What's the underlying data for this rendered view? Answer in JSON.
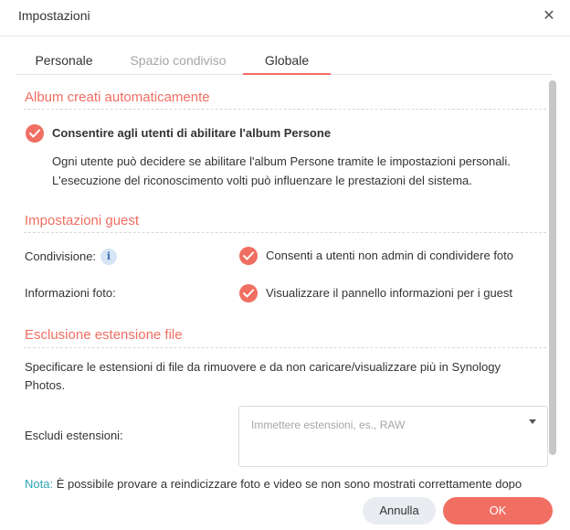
{
  "dialog": {
    "title": "Impostazioni"
  },
  "tabs": [
    {
      "label": "Personale"
    },
    {
      "label": "Spazio condiviso"
    },
    {
      "label": "Globale"
    }
  ],
  "album": {
    "heading": "Album creati automaticamente",
    "option_label": "Consentire agli utenti di abilitare l'album Persone",
    "desc_line1": "Ogni utente può decidere se abilitare l'album Persone tramite le impostazioni personali.",
    "desc_line2": "L'esecuzione del riconoscimento volti può influenzare le prestazioni del sistema."
  },
  "guest": {
    "heading": "Impostazioni guest",
    "sharing_label": "Condivisione:",
    "sharing_option": "Consenti a utenti non admin di condividere foto",
    "photoinfo_label": "Informazioni foto:",
    "photoinfo_option": "Visualizzare il pannello informazioni per i guest"
  },
  "exclusion": {
    "heading": "Esclusione estensione file",
    "desc_line1": "Specificare le estensioni di file da rimuovere e da non caricare/visualizzare più in Synology",
    "desc_line2": "Photos.",
    "field_label": "Escludi estensioni:",
    "placeholder": "Immettere estensioni, es., RAW"
  },
  "note": {
    "label": "Nota:",
    "text": " È possibile provare a reindicizzare foto e video se non sono mostrati correttamente dopo"
  },
  "footer": {
    "cancel": "Annulla",
    "ok": "OK"
  },
  "icons": {
    "close": "close-icon",
    "check": "check-icon",
    "info": "info-icon",
    "dropdown": "chevron-down-icon"
  },
  "colors": {
    "accent": "#f06e62",
    "note": "#2aa3b7"
  }
}
